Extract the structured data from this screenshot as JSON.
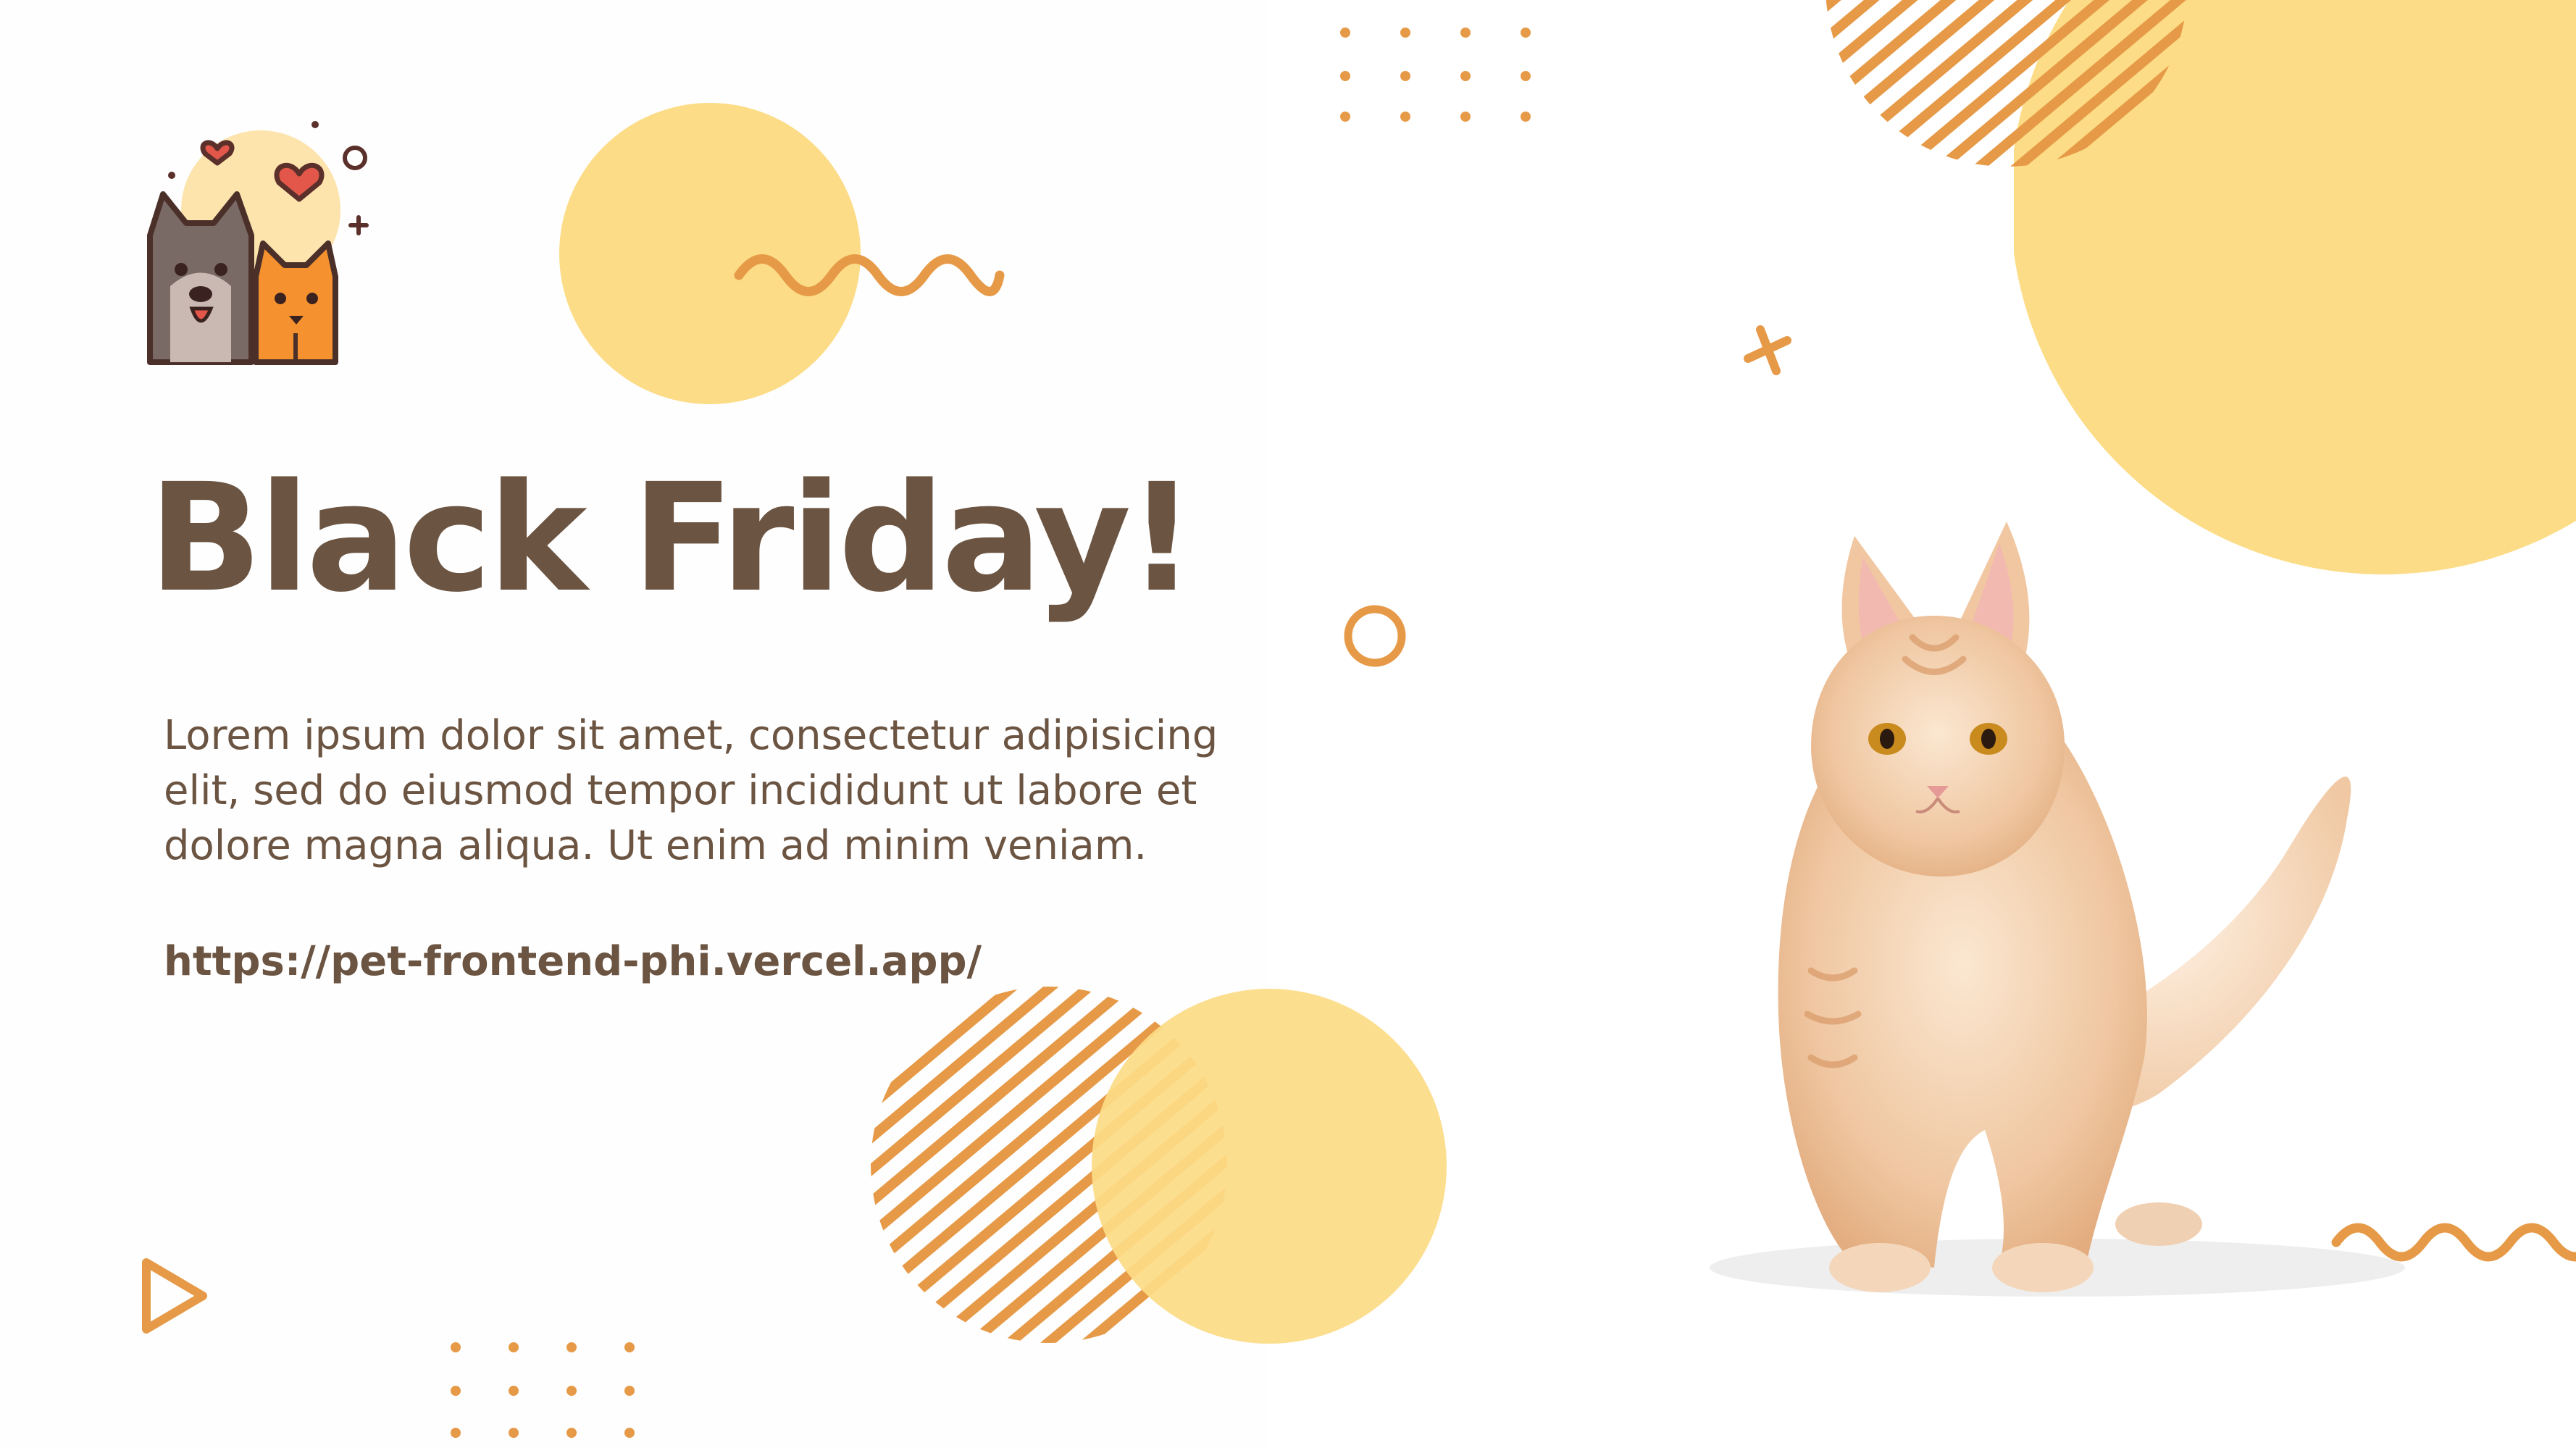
{
  "slide": {
    "title": "Black Friday!",
    "body": "Lorem ipsum dolor sit amet, consectetur adipisicing elit, sed do eiusmod tempor incididunt ut labore et dolore magna aliqua. Ut enim ad minim veniam.",
    "url": "https://pet-frontend-phi.vercel.app/"
  },
  "icons": {
    "logo": "pets-hearts-logo-icon",
    "photo": "orange-cat-photo"
  },
  "colors": {
    "text_brown": "#6b5441",
    "accent_orange": "#e69a47",
    "accent_yellow": "#fcdc86",
    "cat_fur": "#efc6a0",
    "heart_red": "#e2574a"
  }
}
